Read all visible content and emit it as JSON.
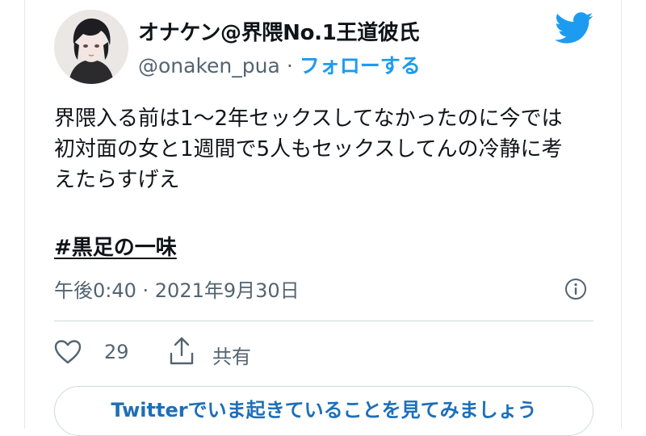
{
  "user": {
    "display_name": "オナケン@界隈No.1王道彼氏",
    "handle": "@onaken_pua",
    "separator": "·",
    "follow_label": "フォローする",
    "avatar_icon": "user-avatar-photo"
  },
  "brand": {
    "icon": "twitter-bird-icon",
    "color": "#1d9bf0"
  },
  "tweet": {
    "lines": [
      "界隈入る前は1〜2年セックスしてなかったのに今では",
      "初対面の女と1週間で5人もセックスしてんの冷静に考",
      "えたらすげえ"
    ],
    "hashtag": "#黒足の一味",
    "timestamp": "午後0:40 · 2021年9月30日",
    "info_icon": "info-icon"
  },
  "actions": {
    "like_icon": "heart-icon",
    "like_count": "29",
    "share_icon": "share-icon",
    "share_label": "共有"
  },
  "cta": {
    "label": "Twitterでいま起きていることを見てみましょう"
  }
}
